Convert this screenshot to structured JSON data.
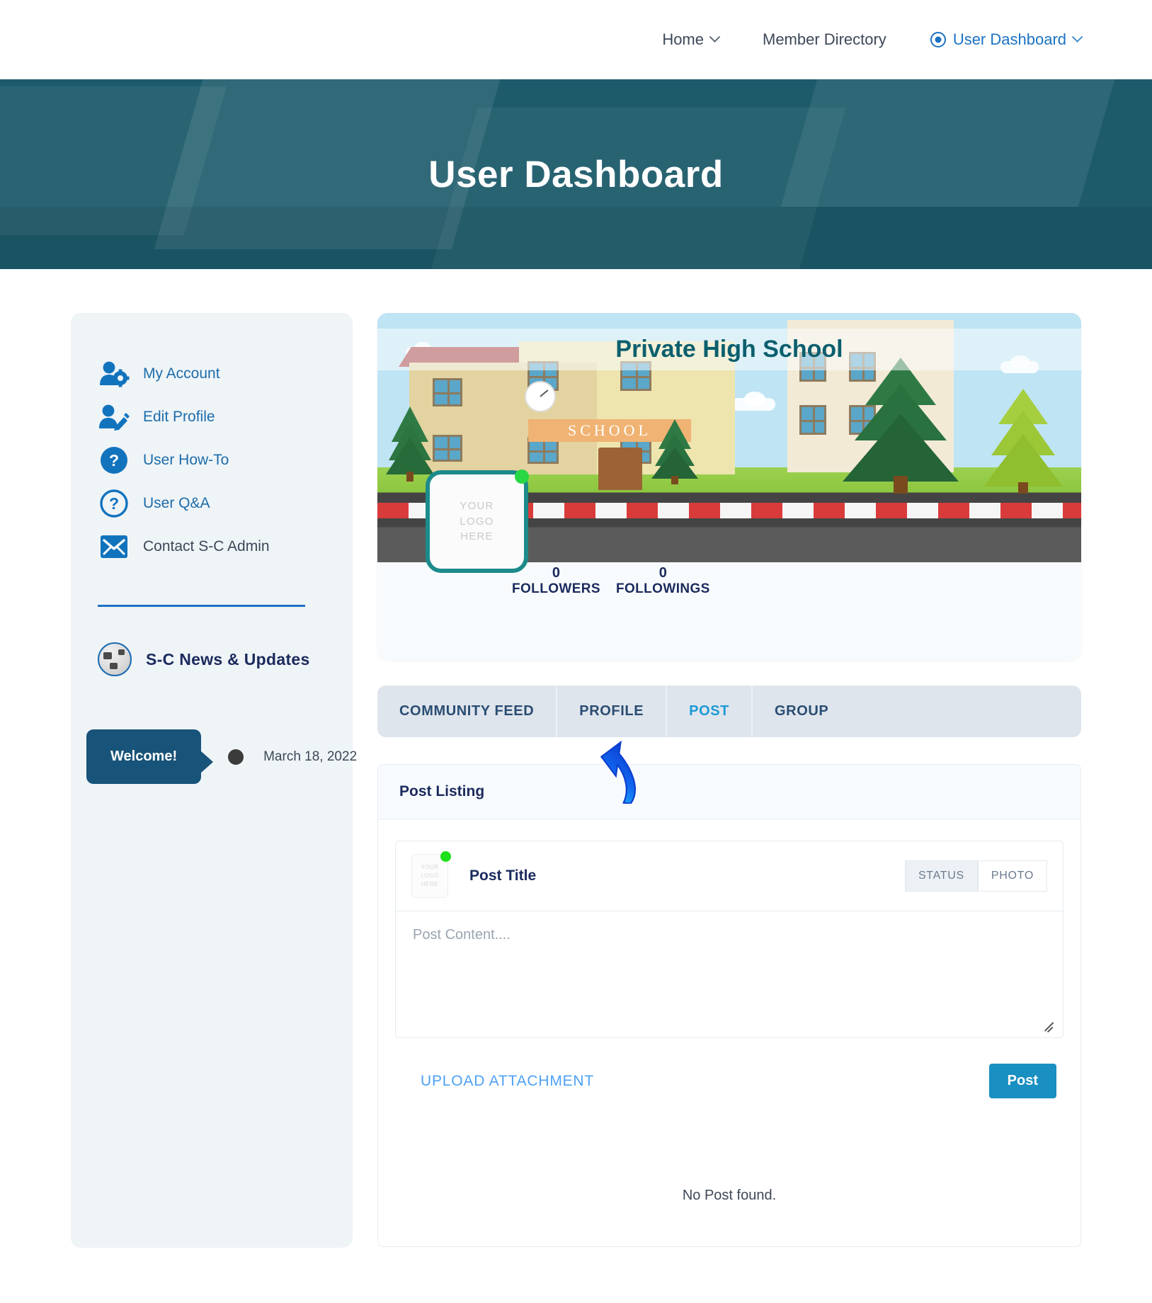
{
  "nav": {
    "items": [
      {
        "label": "Home",
        "icon": "chevron-down-icon",
        "active": false
      },
      {
        "label": "Member Directory",
        "icon": "",
        "active": false
      },
      {
        "label": "User Dashboard",
        "icon": "radio-selected-icon",
        "active": true
      }
    ]
  },
  "hero": {
    "title": "User Dashboard"
  },
  "sidebar": {
    "items": [
      {
        "label": "My Account",
        "icon": "user-gear-icon"
      },
      {
        "label": "Edit Profile",
        "icon": "user-pencil-icon"
      },
      {
        "label": "User How-To",
        "icon": "question-filled-icon"
      },
      {
        "label": "User Q&A",
        "icon": "question-outline-icon"
      },
      {
        "label": "Contact S-C Admin",
        "icon": "envelope-icon"
      }
    ],
    "news": {
      "title": "S-C News & Updates",
      "icon": "globe-icon"
    },
    "timeline": {
      "badge": "Welcome!",
      "date": "March 18, 2022"
    }
  },
  "cover": {
    "school_name": "Private High School",
    "school_sign": "SCHOOL",
    "avatar_text": "YOUR\nLOGO\nHERE",
    "avatar_line1": "YOUR",
    "avatar_line2": "LOGO",
    "avatar_line3": "HERE",
    "stats": [
      {
        "count": "0",
        "label": "FOLLOWERS"
      },
      {
        "count": "0",
        "label": "FOLLOWINGS"
      }
    ]
  },
  "tabs": [
    {
      "label": "COMMUNITY FEED",
      "selected": false
    },
    {
      "label": "PROFILE",
      "selected": false
    },
    {
      "label": "POST",
      "selected": true
    },
    {
      "label": "GROUP",
      "selected": false
    }
  ],
  "post_panel": {
    "heading": "Post Listing",
    "post_title": "Post Title",
    "avatar_line1": "YOUR",
    "avatar_line2": "LOGO",
    "avatar_line3": "HERE",
    "chips": [
      {
        "label": "STATUS",
        "active": true
      },
      {
        "label": "PHOTO",
        "active": false
      }
    ],
    "content_placeholder": "Post Content....",
    "upload_label": "UPLOAD ATTACHMENT",
    "post_button": "Post",
    "empty_message": "No Post found."
  },
  "colors": {
    "brand_blue": "#1b72c2",
    "hero_teal": "#1d5b6b",
    "tab_active": "#1c9ad6",
    "post_button": "#1a8fc1",
    "sidebar_bg": "#eff4f7",
    "badge_navy": "#185379",
    "online_green": "#28d744",
    "avatar_border": "#1d8b8b"
  }
}
